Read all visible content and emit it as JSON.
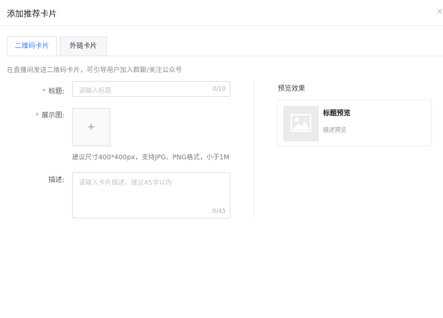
{
  "dialog": {
    "title": "添加推荐卡片",
    "close_icon": "close-icon"
  },
  "tabs": [
    {
      "label": "二维码卡片",
      "active": true
    },
    {
      "label": "外链卡片",
      "active": false
    }
  ],
  "description": "在直播间发送二维码卡片，可引导用户加入群聊/关注公众号",
  "form": {
    "required_mark": "*",
    "title_field": {
      "label": "标题:",
      "placeholder": "请输入标题",
      "count": "0/10"
    },
    "image_field": {
      "label": "展示图:",
      "upload_icon": "plus-icon",
      "hint": "建议尺寸400*400px，支持JPG、PNG格式，小于1M"
    },
    "desc_field": {
      "label": "描述:",
      "placeholder": "请输入卡片描述，建议45字以内",
      "count": "0/45"
    }
  },
  "preview": {
    "title": "预览效果",
    "card_name": "标题预览",
    "card_desc": "描述预览",
    "image_icon": "image-placeholder-icon"
  },
  "colors": {
    "accent": "#3f7ef0",
    "required": "#f56c6c",
    "border": "#dcdfe6"
  }
}
